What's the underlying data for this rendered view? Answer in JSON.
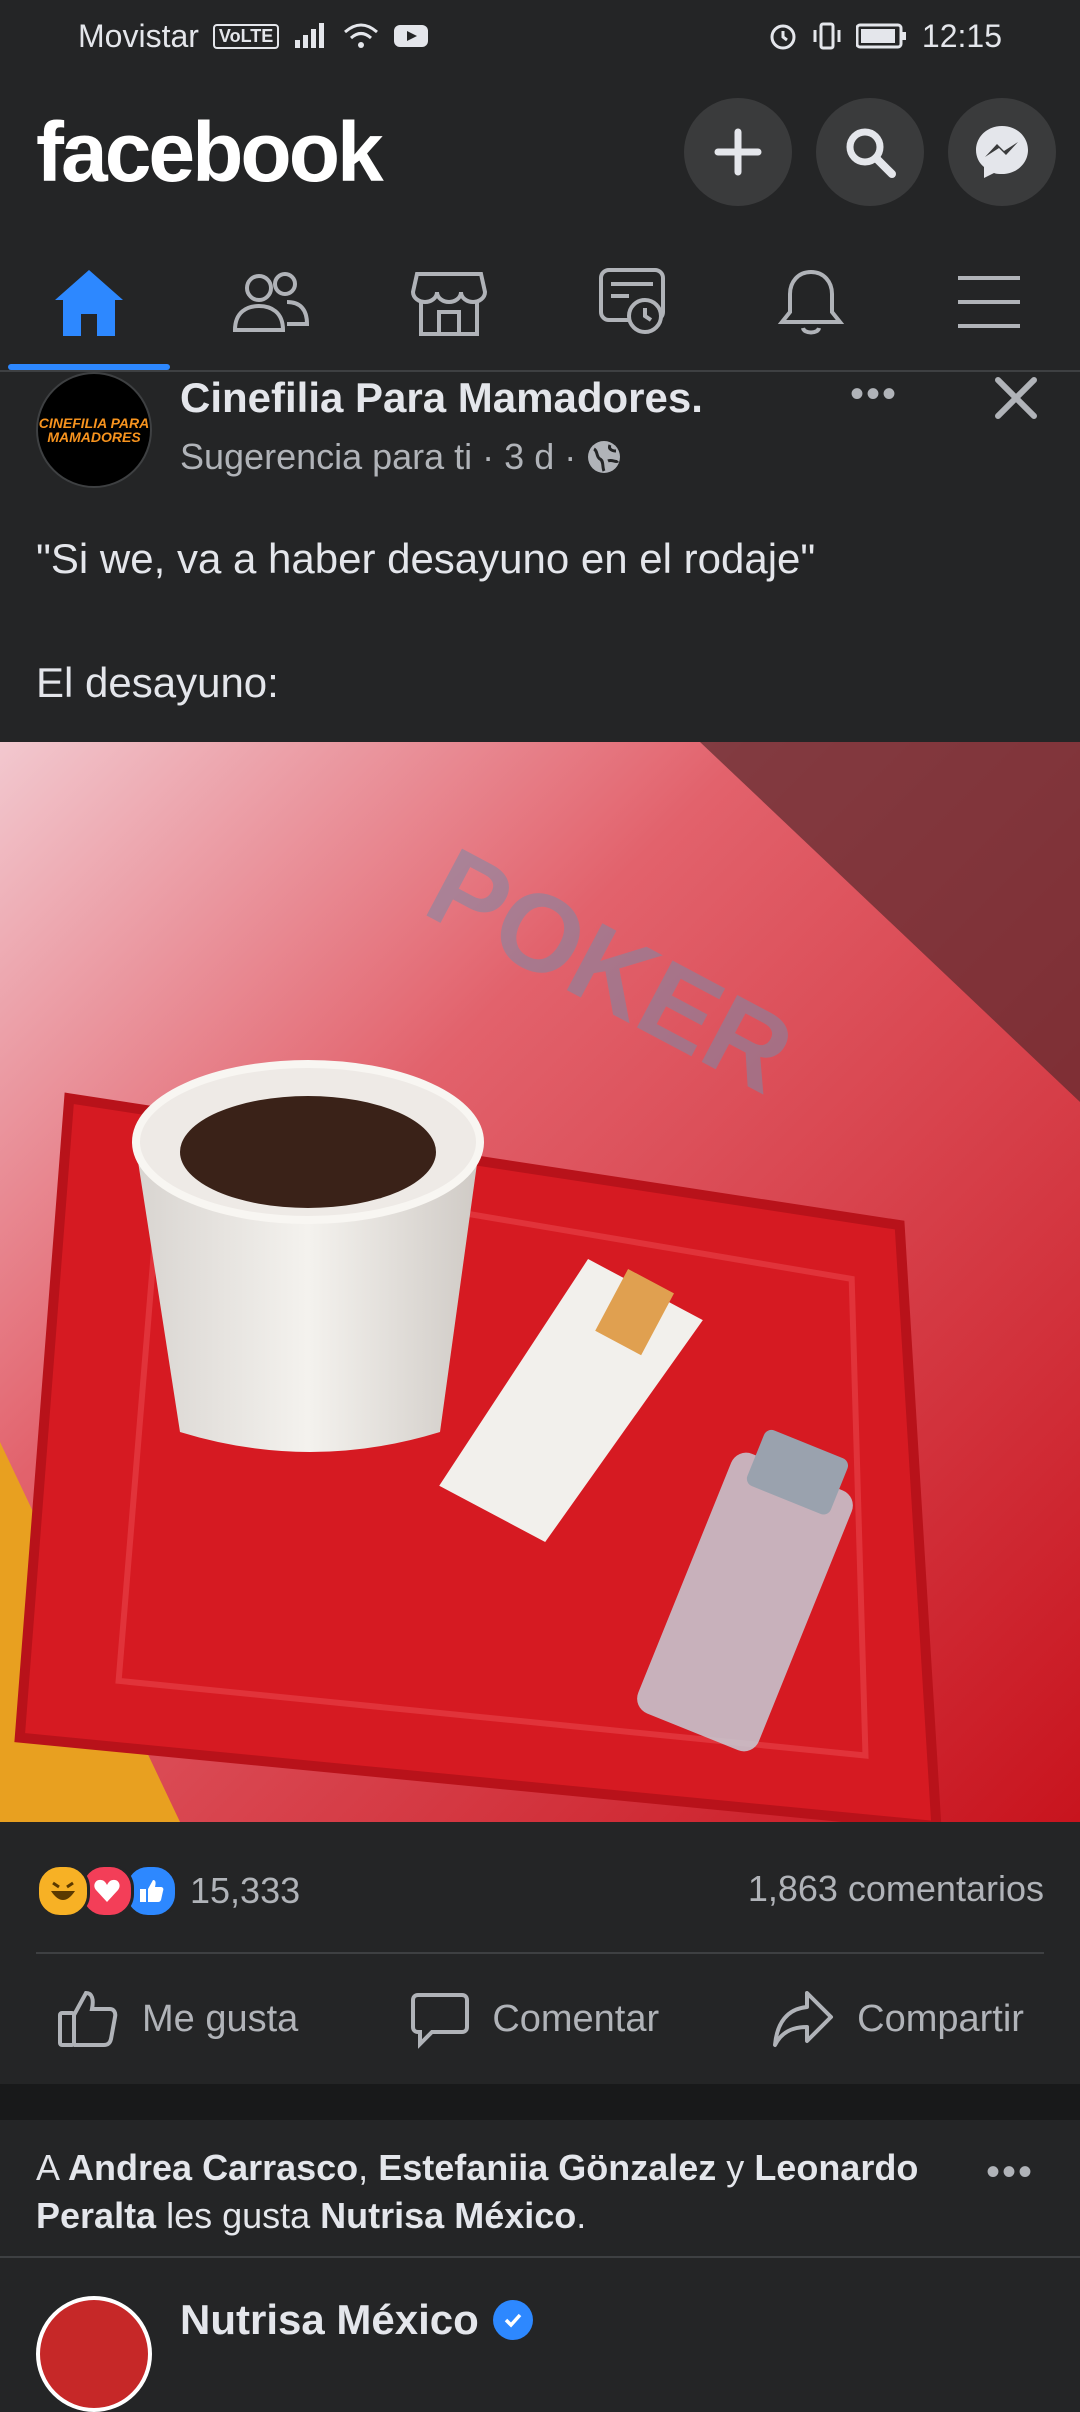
{
  "status_bar": {
    "carrier": "Movistar",
    "volte": "VoLTE",
    "time": "12:15"
  },
  "header": {
    "logo": "facebook",
    "actions": [
      "plus-icon",
      "search-icon",
      "messenger-icon"
    ]
  },
  "nav": {
    "tabs": [
      "home-icon",
      "friends-icon",
      "marketplace-icon",
      "watch-icon",
      "notifications-icon",
      "menu-icon"
    ],
    "active_tab": "home-icon"
  },
  "post": {
    "page_name": "Cinefilia Para Mamadores.",
    "avatar_text": [
      "CINEFILIA PARA",
      "MAMADORES"
    ],
    "meta": "Sugerencia para ti · 3 d ·",
    "text_line1": "\"Si we, va a haber desayuno en el rodaje\"",
    "text_line2": "El desayuno:",
    "photo_watermark": "POKER",
    "reactions": [
      "haha",
      "love",
      "like"
    ],
    "reaction_count": "15,333",
    "comments": "1,863 comentarios",
    "actions": {
      "like": "Me gusta",
      "comment": "Comentar",
      "share": "Compartir"
    }
  },
  "next_post": {
    "ctx_prefix": "A ",
    "friend1": "Andrea Carrasco",
    "sep1": ", ",
    "friend2": "Estefaniia Gönzalez",
    "sep2": " y ",
    "friend3": "Leonardo Peralta",
    "ctx_mid": " les gusta ",
    "liked_page": "Nutrisa México",
    "ctx_end": ".",
    "page_name": "Nutrisa México"
  },
  "colors": {
    "background": "#242526",
    "accent": "#2d88ff",
    "text": "#e4e6eb",
    "muted": "#b0b3b8"
  }
}
